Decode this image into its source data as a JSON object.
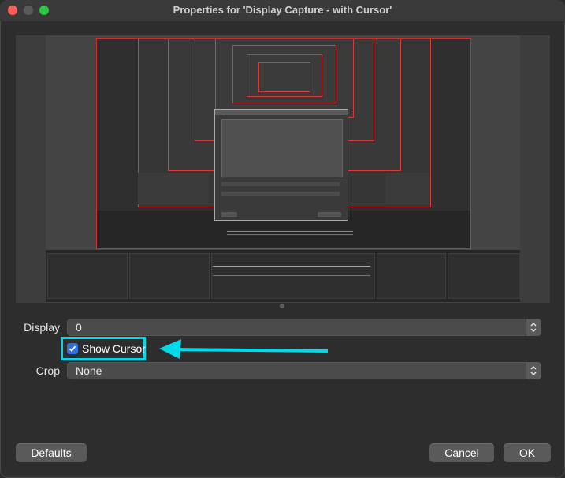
{
  "window": {
    "title": "Properties for 'Display Capture - with Cursor'"
  },
  "form": {
    "display": {
      "label": "Display",
      "value": "0"
    },
    "show_cursor": {
      "label": "Show Cursor",
      "checked": true
    },
    "crop": {
      "label": "Crop",
      "value": "None"
    }
  },
  "buttons": {
    "defaults": "Defaults",
    "cancel": "Cancel",
    "ok": "OK"
  },
  "colors": {
    "annotation": "#00d9e8",
    "checkbox": "#2f6fe0",
    "preview_border": "#d62b2b"
  }
}
